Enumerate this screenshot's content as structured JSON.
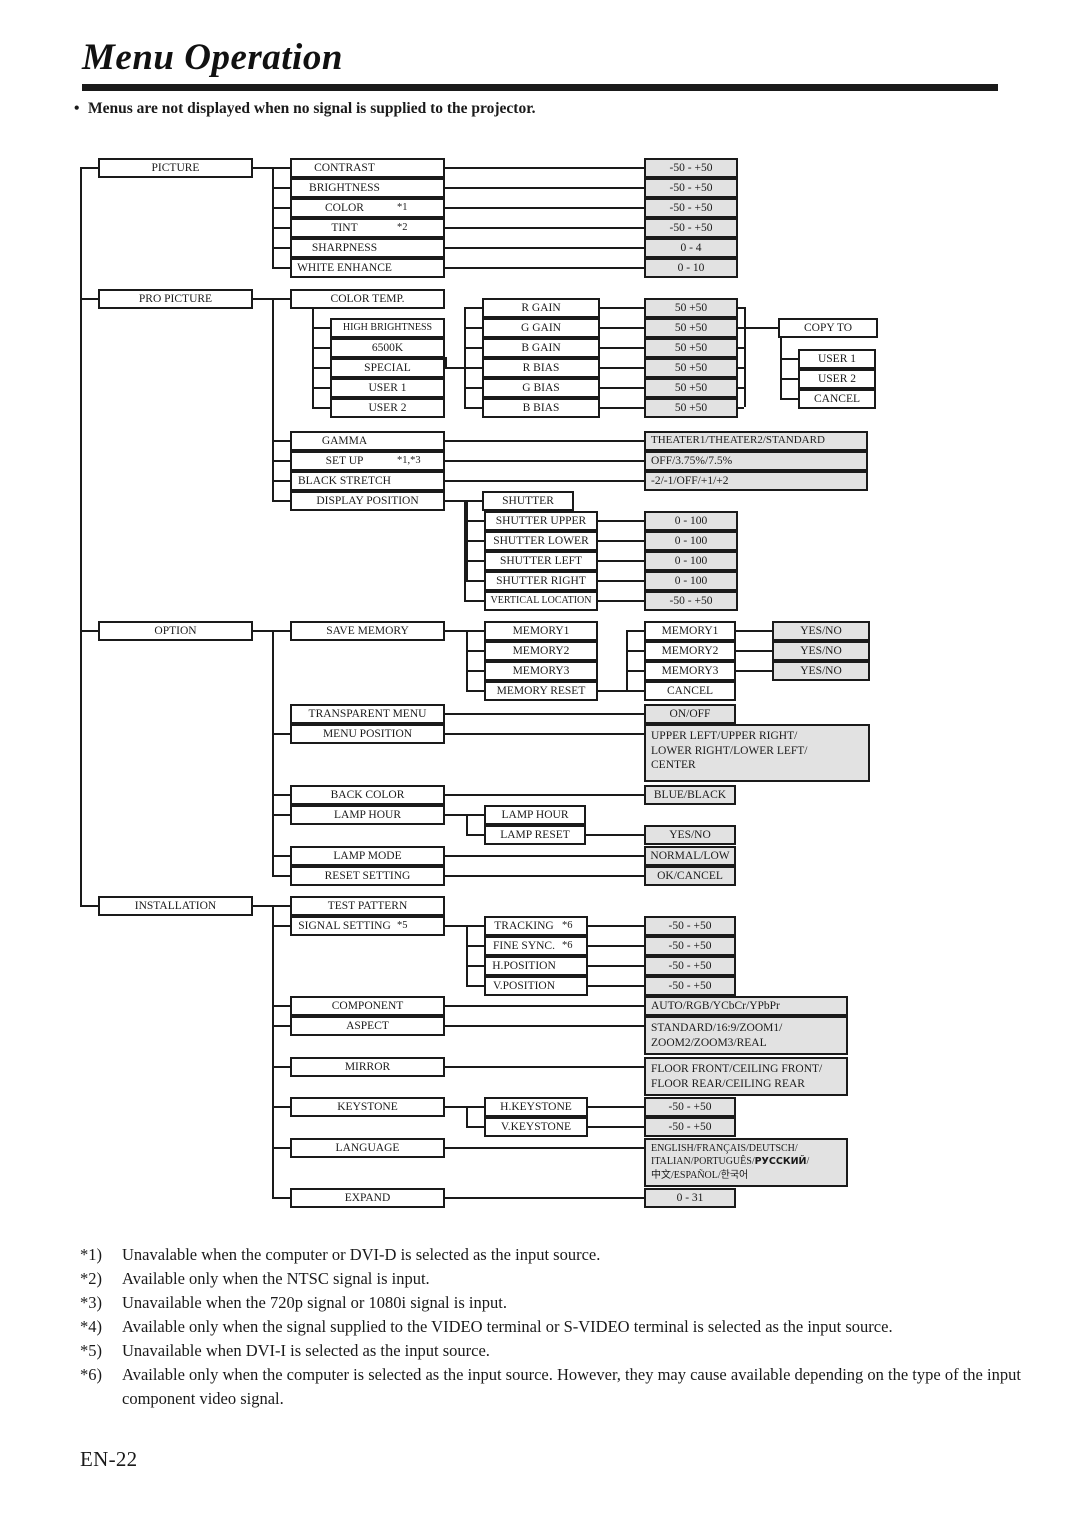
{
  "header": {
    "title": "Menu Operation",
    "note_bullet": "•",
    "note": "Menus are not displayed when no signal is supplied to the projector."
  },
  "menu_tree": {
    "roots": [
      {
        "label": "PICTURE"
      },
      {
        "label": "PRO PICTURE"
      },
      {
        "label": "OPTION"
      },
      {
        "label": "INSTALLATION"
      }
    ],
    "picture": {
      "items": [
        {
          "label": "CONTRAST",
          "asterisk": "",
          "value": "-50 - +50"
        },
        {
          "label": "BRIGHTNESS",
          "asterisk": "",
          "value": "-50 - +50"
        },
        {
          "label": "COLOR",
          "asterisk": "*1",
          "value": "-50 - +50"
        },
        {
          "label": "TINT",
          "asterisk": "*2",
          "value": "-50 - +50"
        },
        {
          "label": "SHARPNESS",
          "asterisk": "",
          "value": "0 - 4"
        },
        {
          "label": "WHITE ENHANCE",
          "asterisk": "",
          "value": "0 - 10"
        }
      ]
    },
    "pro_picture": {
      "color_temp": {
        "label": "COLOR TEMP."
      },
      "color_temp_presets": [
        "HIGH BRIGHTNESS",
        "6500K",
        "SPECIAL",
        "USER 1",
        "USER 2"
      ],
      "color_temp_params": [
        {
          "label": "R GAIN",
          "value": "50   +50"
        },
        {
          "label": "G GAIN",
          "value": "50   +50"
        },
        {
          "label": "B GAIN",
          "value": "50   +50"
        },
        {
          "label": "R BIAS",
          "value": "50   +50"
        },
        {
          "label": "G BIAS",
          "value": "50   +50"
        },
        {
          "label": "B BIAS",
          "value": "50   +50"
        }
      ],
      "copy_to": {
        "label": "COPY TO"
      },
      "copy_to_targets": [
        "USER 1",
        "USER 2",
        "CANCEL"
      ],
      "direct": [
        {
          "label": "GAMMA",
          "asterisk": "",
          "value": "THEATER1/THEATER2/STANDARD"
        },
        {
          "label": "SET UP",
          "asterisk": "*1,*3",
          "value": "OFF/3.75%/7.5%"
        },
        {
          "label": "BLACK STRETCH",
          "asterisk": "",
          "value": "-2/-1/OFF/+1/+2"
        }
      ],
      "display_position": {
        "label": "DISPLAY POSITION"
      },
      "shutter": {
        "label": "SHUTTER"
      },
      "shutter_items": [
        {
          "label": "SHUTTER UPPER",
          "value": "0 - 100"
        },
        {
          "label": "SHUTTER LOWER",
          "value": "0 - 100"
        },
        {
          "label": "SHUTTER LEFT",
          "value": "0 - 100"
        },
        {
          "label": "SHUTTER RIGHT",
          "value": "0 - 100"
        },
        {
          "label": "VERTICAL LOCATION",
          "value": "-50 - +50"
        }
      ]
    },
    "option": {
      "save_memory": {
        "label": "SAVE MEMORY"
      },
      "save_memory_slots": [
        "MEMORY1",
        "MEMORY2",
        "MEMORY3",
        "MEMORY RESET"
      ],
      "memory_reset_slots": [
        {
          "label": "MEMORY1",
          "value": "YES/NO"
        },
        {
          "label": "MEMORY2",
          "value": "YES/NO"
        },
        {
          "label": "MEMORY3",
          "value": "YES/NO"
        },
        {
          "label": "CANCEL",
          "value": ""
        }
      ],
      "transparent_menu": {
        "label": "TRANSPARENT MENU",
        "value": "ON/OFF"
      },
      "menu_position": {
        "label": "MENU POSITION",
        "value": "UPPER LEFT/UPPER RIGHT/\nLOWER RIGHT/LOWER LEFT/\nCENTER"
      },
      "back_color": {
        "label": "BACK COLOR",
        "value": "BLUE/BLACK"
      },
      "lamp_hour": {
        "label": "LAMP HOUR"
      },
      "lamp_hour_sub": [
        {
          "label": "LAMP HOUR",
          "value": ""
        },
        {
          "label": "LAMP RESET",
          "value": "YES/NO"
        }
      ],
      "lamp_mode": {
        "label": "LAMP MODE",
        "value": "NORMAL/LOW"
      },
      "reset_setting": {
        "label": "RESET SETTING",
        "value": "OK/CANCEL"
      }
    },
    "installation": {
      "test_pattern": {
        "label": "TEST PATTERN"
      },
      "signal_setting": {
        "label": "SIGNAL SETTING",
        "asterisk": "*5"
      },
      "signal_items": [
        {
          "label": "TRACKING",
          "asterisk": "*6",
          "value": "-50 - +50"
        },
        {
          "label": "FINE SYNC.",
          "asterisk": "*6",
          "value": "-50 - +50"
        },
        {
          "label": "H.POSITION",
          "asterisk": "",
          "value": "-50 - +50"
        },
        {
          "label": "V.POSITION",
          "asterisk": "",
          "value": "-50 - +50"
        }
      ],
      "component": {
        "label": "COMPONENT",
        "value": "AUTO/RGB/YCbCr/YPbPr"
      },
      "aspect": {
        "label": "ASPECT",
        "value": "STANDARD/16:9/ZOOM1/\nZOOM2/ZOOM3/REAL"
      },
      "mirror": {
        "label": "MIRROR",
        "value": "FLOOR FRONT/CEILING FRONT/\nFLOOR REAR/CEILING REAR"
      },
      "keystone": {
        "label": "KEYSTONE"
      },
      "keystone_items": [
        {
          "label": "H.KEYSTONE",
          "value": "-50 - +50"
        },
        {
          "label": "V.KEYSTONE",
          "value": "-50 - +50"
        }
      ],
      "language": {
        "label": "LANGUAGE"
      },
      "language_values": {
        "line1": "ENGLISH/FRANÇAIS/DEUTSCH/",
        "line2_a": "ITALIAN/PORTUGUÊS/",
        "line2_cyr": "РУССКИЙ",
        "line2_b": "/",
        "line3_cjk": "中文",
        "line3_a": "/ESPAÑOL/",
        "line3_kr": "한국어"
      },
      "expand": {
        "label": "EXPAND",
        "value": "0 - 31"
      }
    }
  },
  "footnotes": [
    {
      "key": "*1)",
      "text": "Unavalable when the computer or DVI-D is selected as the input source."
    },
    {
      "key": "*2)",
      "text": "Available only when the NTSC signal is input."
    },
    {
      "key": "*3)",
      "text": "Unavailable when the 720p signal or 1080i signal is input."
    },
    {
      "key": "*4)",
      "text": "Available only when the signal supplied to the VIDEO terminal or S-VIDEO terminal is selected as the input source."
    },
    {
      "key": "*5)",
      "text": "Unavailable when DVI-I is selected as the input source."
    },
    {
      "key": "*6)",
      "text": "Available only when the computer is selected as the input source. However, they may cause available depending on the type of the input component video signal."
    }
  ],
  "page_number": "EN-22"
}
